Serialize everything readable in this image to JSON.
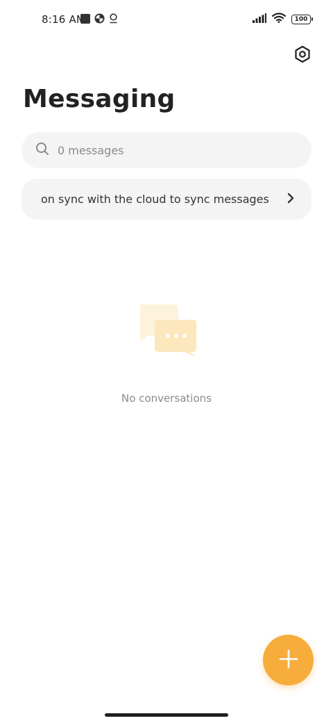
{
  "status_bar": {
    "time": "8:16 AM",
    "battery": "100",
    "left_icons": [
      "notification-square-icon",
      "data-saver-icon",
      "location-pin-icon"
    ],
    "right_icons": [
      "signal-icon",
      "wifi-icon",
      "battery-icon"
    ]
  },
  "header": {
    "title": "Messaging",
    "settings_icon": "gear-icon"
  },
  "search": {
    "placeholder": "0 messages",
    "icon": "search-icon"
  },
  "sync_banner": {
    "text": "on sync with the cloud to sync messages",
    "icon": "chevron-right-icon"
  },
  "empty_state": {
    "text": "No conversations",
    "icon": "chat-bubbles-icon"
  },
  "fab": {
    "icon": "plus-icon",
    "color": "#f7ad3c"
  },
  "colors": {
    "accent": "#f7ad3c",
    "surface": "#f4f4f4",
    "text_primary": "#222222",
    "text_secondary": "#8a8a8a"
  }
}
